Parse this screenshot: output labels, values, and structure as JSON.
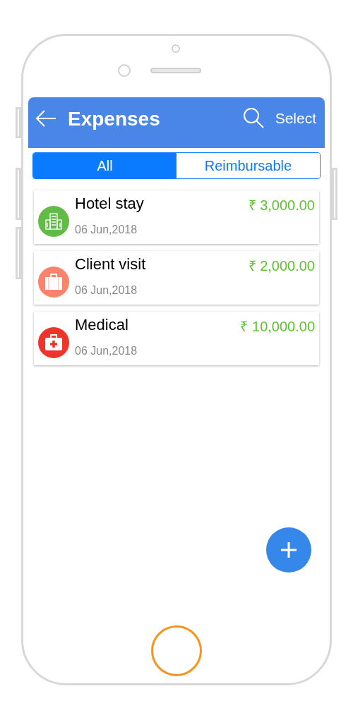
{
  "header": {
    "title": "Expenses",
    "action": "Select"
  },
  "tabs": [
    {
      "label": "All",
      "selected": true
    },
    {
      "label": "Reimbursable",
      "selected": false
    }
  ],
  "expenses": [
    {
      "kind": "building",
      "color": "#62bb47",
      "title": "Hotel stay",
      "date": "06 Jun,2018",
      "amount": "₹ 3,000.00"
    },
    {
      "kind": "suitcase",
      "color": "#fb826b",
      "title": "Client visit",
      "date": "06 Jun,2018",
      "amount": "₹ 2,000.00"
    },
    {
      "kind": "medkit",
      "color": "#f0342a",
      "title": "Medical",
      "date": "06 Jun,2018",
      "amount": "₹ 10,000.00"
    }
  ]
}
